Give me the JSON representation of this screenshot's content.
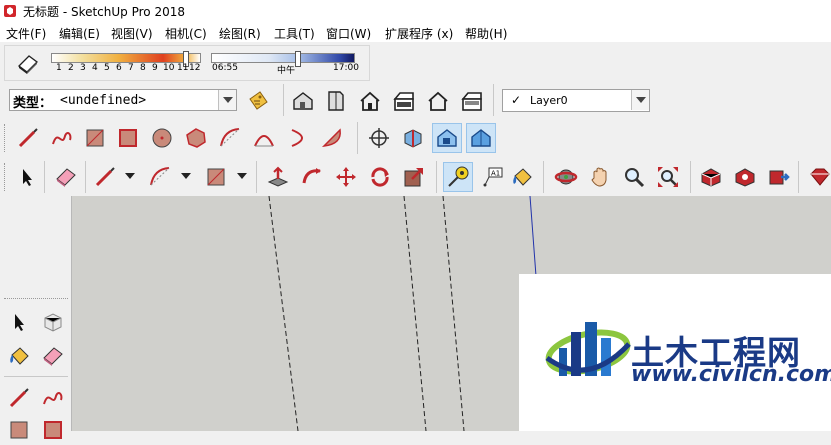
{
  "window": {
    "title": "无标题 - SketchUp Pro 2018"
  },
  "menu": [
    {
      "label": "文件(F)"
    },
    {
      "label": "编辑(E)"
    },
    {
      "label": "视图(V)"
    },
    {
      "label": "相机(C)"
    },
    {
      "label": "绘图(R)"
    },
    {
      "label": "工具(T)"
    },
    {
      "label": "窗口(W)"
    },
    {
      "label": "扩展程序 (x)"
    },
    {
      "label": "帮助(H)"
    }
  ],
  "shadow": {
    "months": [
      "1",
      "2",
      "3",
      "4",
      "5",
      "6",
      "7",
      "8",
      "9",
      "10",
      "11",
      "12"
    ],
    "time_start": "06:55",
    "time_mid": "中午",
    "time_end": "17:00",
    "month_slider_value": 11,
    "time_slider_fraction": 0.6
  },
  "type_select": {
    "label": "类型：",
    "value": "<undefined>"
  },
  "layer_select": {
    "check": "✓",
    "value": "Layer0"
  },
  "watermark": {
    "title": "土木工程网",
    "url": "www.civilcn.com"
  },
  "colors": {
    "accent_red": "#c0282d",
    "accent_blue": "#1a3a86",
    "select_bg": "#cde4f7"
  }
}
